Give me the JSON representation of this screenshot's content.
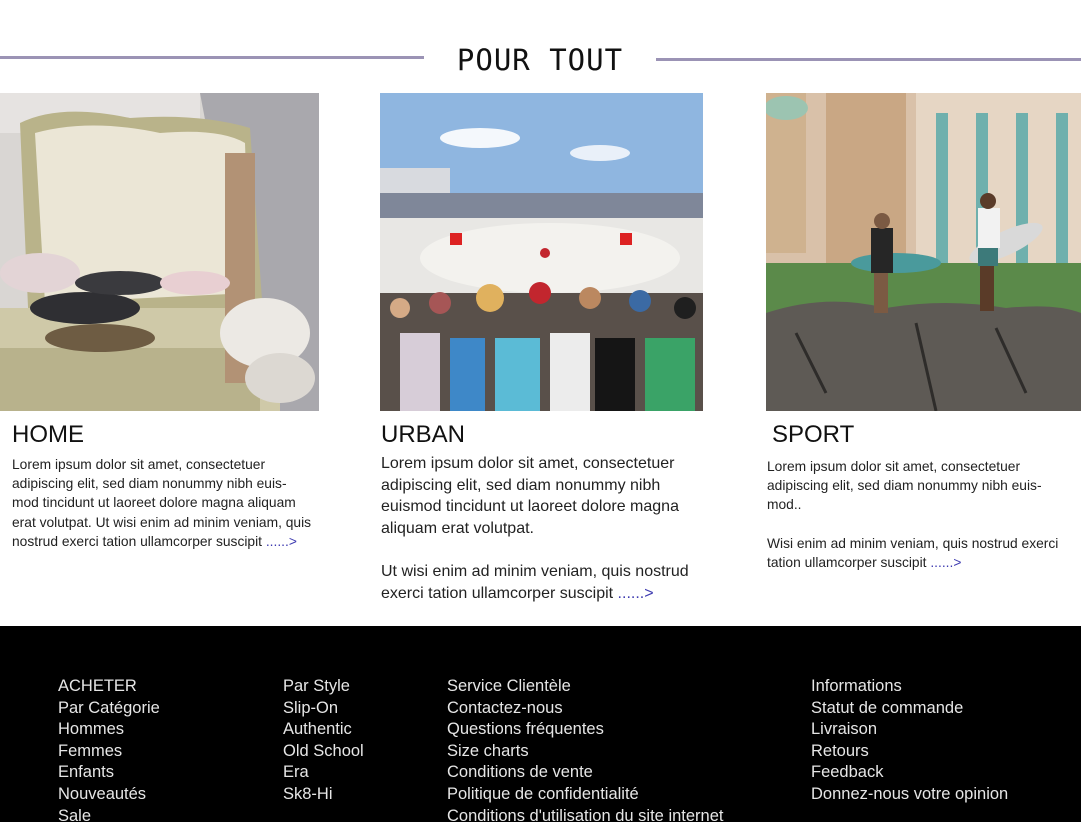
{
  "section": {
    "title": "POUR TOUT"
  },
  "cards": [
    {
      "title": "HOME",
      "text": "Lorem ipsum dolor sit amet, consectetuer adipiscing elit, sed diam nonummy nibh euis-mod tincidunt ut laoreet dolore magna aliquam erat volutpat. Ut wisi enim ad minim veniam, quis nostrud exerci tation ullamcorper suscipit",
      "more": "......>"
    },
    {
      "title": "URBAN",
      "text1": "Lorem ipsum dolor sit amet, consectetuer adipiscing elit, sed diam nonummy nibh euismod tincidunt ut laoreet dolore magna aliquam erat volutpat.",
      "text2": "Ut wisi enim ad minim veniam, quis nostrud exerci tation ullamcorper suscipit",
      "more": "......>"
    },
    {
      "title": "SPORT",
      "text1": "Lorem ipsum dolor sit amet, consectetuer adipiscing elit, sed diam nonummy nibh euis-mod..",
      "text2": "Wisi enim ad minim veniam, quis nostrud exerci tation ullamcorper suscipit",
      "more": "......>"
    }
  ],
  "footer": {
    "col1": [
      "ACHETER",
      "Par Catégorie",
      "Hommes",
      "Femmes",
      "Enfants",
      "Nouveautés",
      "Sale"
    ],
    "col2": [
      "Par Style",
      "Slip-On",
      "Authentic",
      "Old School",
      "Era",
      "Sk8-Hi"
    ],
    "col3": [
      "Service Clientèle",
      "Contactez-nous",
      "Questions fréquentes",
      "Size charts",
      "Conditions de vente",
      "Politique de confidentialité",
      "Conditions d'utilisation du site internet"
    ],
    "col4": [
      "Informations",
      "Statut de commande",
      "Livraison",
      "Retours",
      "Feedback",
      "Donnez-nous votre opinion"
    ]
  },
  "colors": {
    "accent_line": "#9b93b5",
    "link": "#3d3ab0",
    "footer_bg": "#000000"
  }
}
